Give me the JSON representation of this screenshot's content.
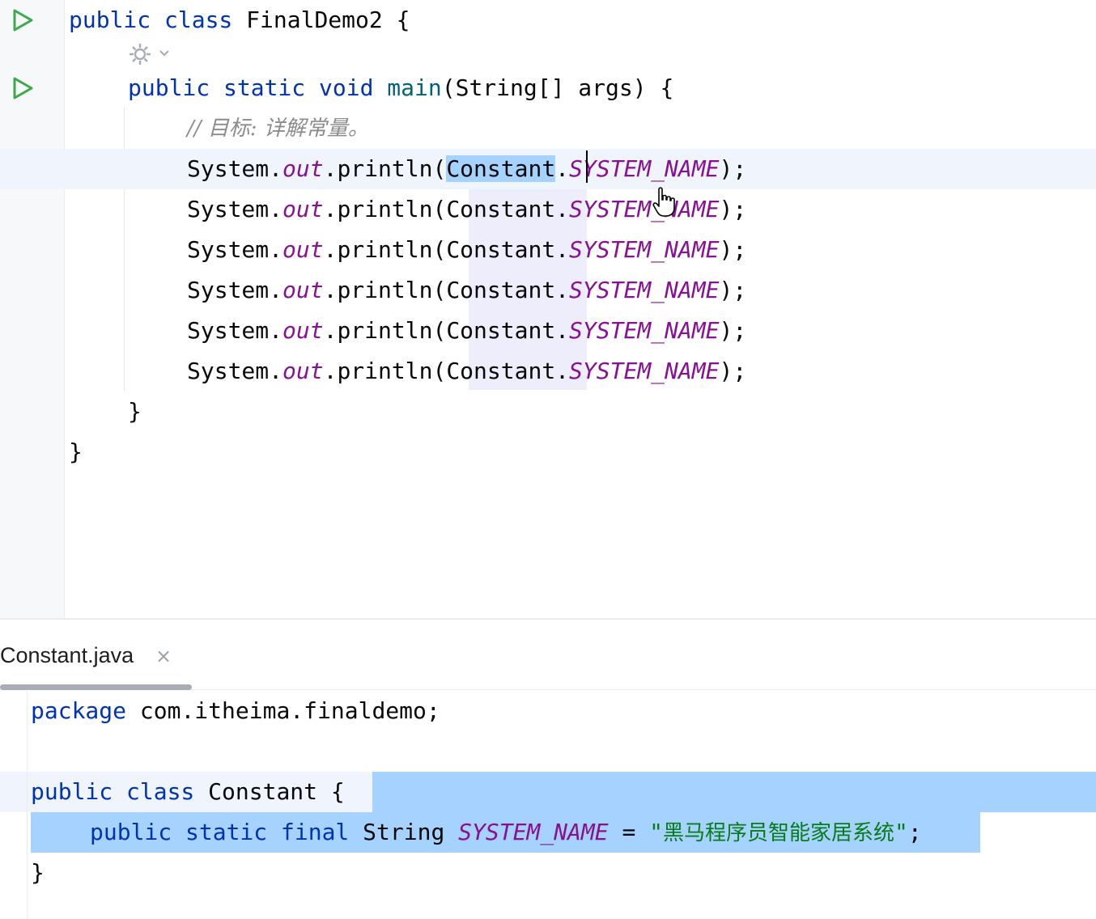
{
  "editor_top": {
    "lines": [
      {
        "kw": "public class",
        "name": "FinalDemo2",
        "brace": "{"
      },
      {
        "kw1": "public static void",
        "fn": "main",
        "params": "(String[] args)",
        "brace": "{"
      },
      {
        "comment": "// 目标: 详解常量。"
      },
      {
        "prefix": "System.",
        "out": "out",
        "mid": ".println(",
        "cls": "Constant",
        "dot": ".",
        "field": "SYSTEM_NAME",
        "end": ");"
      },
      {
        "prefix": "System.",
        "out": "out",
        "mid": ".println(",
        "cls": "Constant",
        "dot": ".",
        "field": "SYSTEM_NAME",
        "end": ");"
      },
      {
        "prefix": "System.",
        "out": "out",
        "mid": ".println(",
        "cls": "Constant",
        "dot": ".",
        "field": "SYSTEM_NAME",
        "end": ");"
      },
      {
        "prefix": "System.",
        "out": "out",
        "mid": ".println(",
        "cls": "Constant",
        "dot": ".",
        "field": "SYSTEM_NAME",
        "end": ");"
      },
      {
        "prefix": "System.",
        "out": "out",
        "mid": ".println(",
        "cls": "Constant",
        "dot": ".",
        "field": "SYSTEM_NAME",
        "end": ");"
      },
      {
        "prefix": "System.",
        "out": "out",
        "mid": ".println(",
        "cls": "Constant",
        "dot": ".",
        "field": "SYSTEM_NAME",
        "end": ");"
      },
      {
        "brace": "}"
      },
      {
        "brace": "}"
      }
    ]
  },
  "editor_bottom": {
    "tab": {
      "label": "Constant.java",
      "close": "×"
    },
    "lines": [
      {
        "kw": "package",
        "rest": " com.itheima.finaldemo;"
      },
      {
        "kw": "public class",
        "name": " Constant ",
        "brace": "{"
      },
      {
        "kw": "public static final",
        "type": " String ",
        "field": "SYSTEM_NAME",
        "eq": " = ",
        "str_open": "\"",
        "str": "黑马程序员智能家居系统",
        "str_close": "\"",
        "end": ";"
      },
      {
        "brace": "}"
      }
    ]
  },
  "icons": {
    "run": "run-triangle-icon",
    "gear": "gear-icon",
    "chevron": "chevron-down-icon",
    "cursor": "hand-cursor-icon"
  },
  "colors": {
    "keyword": "#0033b3",
    "method": "#00627a",
    "static_field": "#871094",
    "comment": "#8c8c8c",
    "string": "#067d17",
    "selection": "#a6d2ff",
    "current_line": "#f0f4fd",
    "run_icon": "#3ea94b"
  }
}
